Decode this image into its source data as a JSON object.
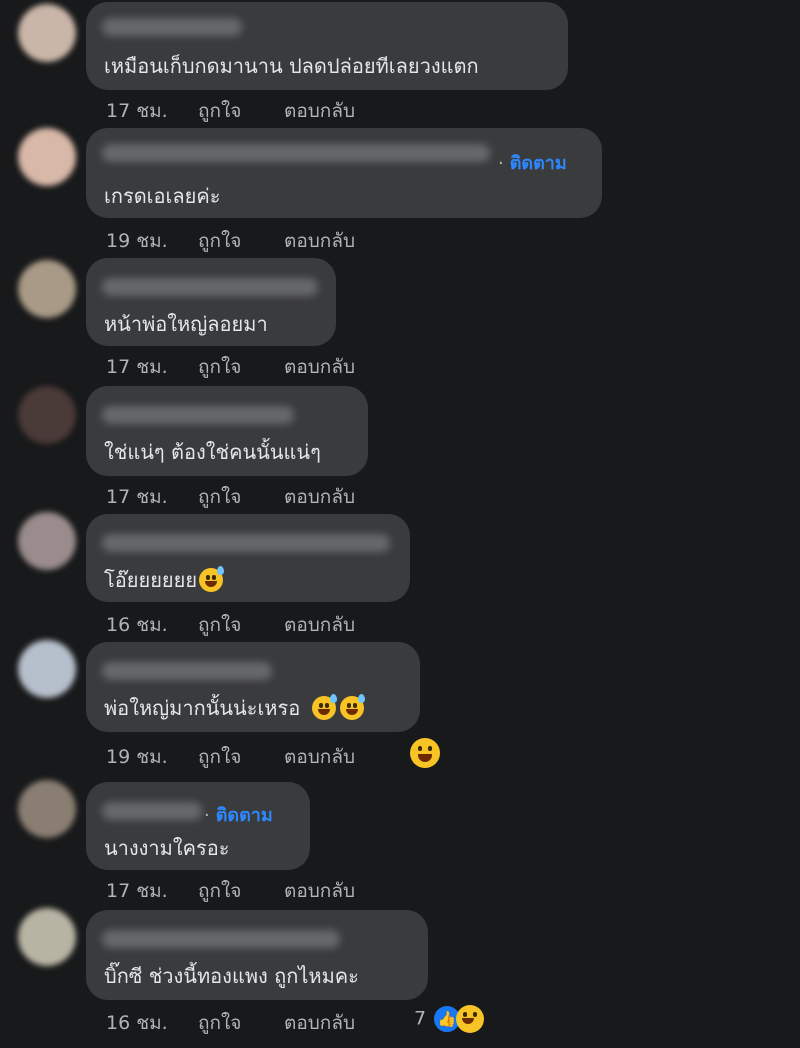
{
  "comments": [
    {
      "text": "เหมือนเก็บกดมานาน ปลดปล่อยทีเลยวงแตก",
      "time": "17 ชม.",
      "like": "ถูกใจ",
      "reply": "ตอบกลับ",
      "avatar_color": "#c9b6a8"
    },
    {
      "text": "เกรดเอเลยค่ะ",
      "time": "19 ชม.",
      "like": "ถูกใจ",
      "reply": "ตอบกลับ",
      "follow": "ติดตาม",
      "avatar_color": "#d8b8a8"
    },
    {
      "text": "หน้าพ่อใหญ่ลอยมา",
      "time": "17 ชม.",
      "like": "ถูกใจ",
      "reply": "ตอบกลับ",
      "avatar_color": "#a89a86"
    },
    {
      "text": "ใช่แน่ๆ ต้องใช่คนนั้นแน่ๆ",
      "time": "17 ชม.",
      "like": "ถูกใจ",
      "reply": "ตอบกลับ",
      "avatar_color": "#4a3a38"
    },
    {
      "text": "โอ๊ยยยยยย",
      "time": "16 ชม.",
      "like": "ถูกใจ",
      "reply": "ตอบกลับ",
      "avatar_color": "#9a8c8c"
    },
    {
      "text": "พ่อใหญ่มากนั้นน่ะเหรอ",
      "time": "19 ชม.",
      "like": "ถูกใจ",
      "reply": "ตอบกลับ",
      "avatar_color": "#b6c0cc"
    },
    {
      "text": "นางงามใครอะ",
      "time": "17 ชม.",
      "like": "ถูกใจ",
      "reply": "ตอบกลับ",
      "follow": "ติดตาม",
      "avatar_color": "#8a7e72"
    },
    {
      "text": "บิ๊กซี ช่วงนี้ทองแพง ถูกไหมคะ",
      "time": "16 ชม.",
      "like": "ถูกใจ",
      "reply": "ตอบกลับ",
      "reaction_count": "7",
      "avatar_color": "#b8b4a4"
    }
  ],
  "icons": {
    "sweat_smile": "grinning-sweat-emoji-icon",
    "laugh": "laughing-emoji-icon",
    "like": "thumbs-up-icon"
  },
  "colors": {
    "background": "#18191a",
    "bubble": "#3a3b3c",
    "link": "#2d88ff",
    "like_badge": "#1877f2"
  }
}
